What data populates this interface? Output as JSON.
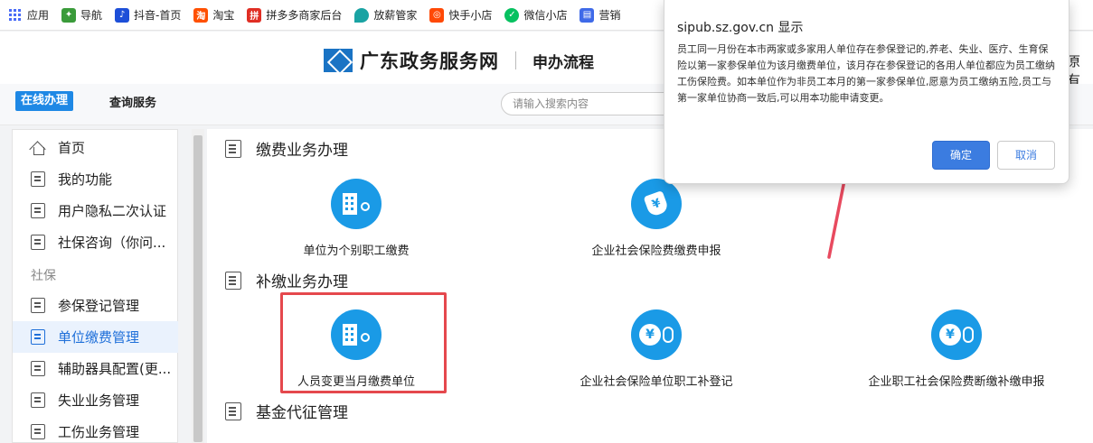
{
  "bookmarks": [
    {
      "label": "应用",
      "icon": "apps-grid-icon",
      "color": "#4a6cf7"
    },
    {
      "label": "导航",
      "icon": "navigation-icon",
      "color": "#3a9b3a"
    },
    {
      "label": "抖音-首页",
      "icon": "douyin-icon",
      "color": "#1d4fd8"
    },
    {
      "label": "淘宝",
      "icon": "taobao-icon",
      "color": "#ff5000"
    },
    {
      "label": "拼多多商家后台",
      "icon": "pinduoduo-icon",
      "color": "#e02e24"
    },
    {
      "label": "放薪管家",
      "icon": "drop-icon",
      "color": "#1aa3a3"
    },
    {
      "label": "快手小店",
      "icon": "kuaishou-icon",
      "color": "#ff4906"
    },
    {
      "label": "微信小店",
      "icon": "wechat-icon",
      "color": "#07c160"
    },
    {
      "label": "营销",
      "icon": "marketing-icon",
      "color": "#3f6ae8"
    }
  ],
  "header": {
    "site_name": "广东政务服务网",
    "subtitle": "申办流程",
    "right_text": "原有"
  },
  "nav": {
    "tab_online": "在线办理",
    "tab_query": "查询服务",
    "search_placeholder": "请输入搜索内容"
  },
  "sidebar": {
    "items": [
      {
        "label": "首页",
        "icon": "home-icon"
      },
      {
        "label": "我的功能",
        "icon": "document-icon"
      },
      {
        "label": "用户隐私二次认证",
        "icon": "building-doc-icon"
      },
      {
        "label": "社保咨询（你问...",
        "icon": "building-doc-icon"
      }
    ],
    "section": "社保",
    "section_items": [
      {
        "label": "参保登记管理",
        "icon": "document-gear-icon"
      },
      {
        "label": "单位缴费管理",
        "icon": "document-pen-icon",
        "active": true
      },
      {
        "label": "辅助器具配置(更...",
        "icon": "document-gear-icon"
      },
      {
        "label": "失业业务管理",
        "icon": "document-yen-icon"
      },
      {
        "label": "工伤业务管理",
        "icon": "document-list-icon"
      }
    ]
  },
  "sections": [
    {
      "title": "缴费业务办理",
      "services": [
        {
          "label": "单位为个别职工缴费",
          "icon": "building-key-icon"
        },
        {
          "label": "企业社会保险费缴费申报",
          "icon": "yen-tag-icon"
        }
      ]
    },
    {
      "title": "补缴业务办理",
      "services": [
        {
          "label": "人员变更当月缴费单位",
          "icon": "building-key-icon"
        },
        {
          "label": "企业社会保险单位职工补登记",
          "icon": "yen-coin-bag-icon"
        },
        {
          "label": "企业职工社会保险费断缴补缴申报",
          "icon": "yen-coin-bag-icon"
        }
      ]
    },
    {
      "title": "基金代征管理",
      "services": []
    }
  ],
  "dialog": {
    "title": "sipub.sz.gov.cn 显示",
    "message": "员工同一月份在本市两家或多家用人单位存在参保登记的,养老、失业、医疗、生育保险以第一家参保单位为该月缴费单位，该月存在参保登记的各用人单位都应为员工缴纳工伤保险费。如本单位作为非员工本月的第一家参保单位,愿意为员工缴纳五险,员工与第一家单位协商一致后,可以用本功能申请变更。",
    "ok_label": "确定",
    "cancel_label": "取消"
  },
  "colors": {
    "accent": "#1e88e5",
    "icon_blue": "#1a9ae6",
    "highlight_red": "#e5484d",
    "arrow_red": "#e84a5f",
    "ok_button": "#3b7ce0"
  }
}
